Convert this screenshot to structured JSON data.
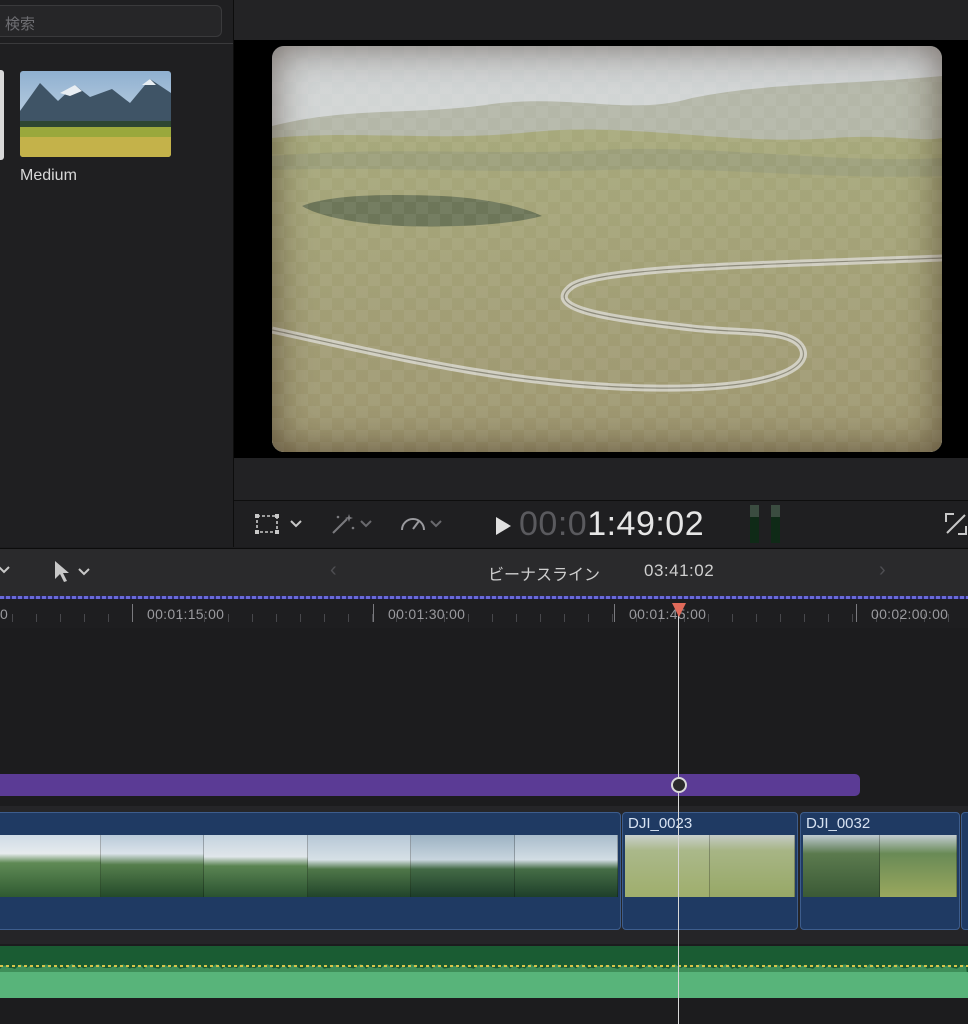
{
  "browser": {
    "search_placeholder": "検索",
    "clip_label": "Medium"
  },
  "viewer": {
    "timecode_dim": "00:0",
    "timecode_lit": "1:49:02"
  },
  "timeline": {
    "project_name": "ビーナスライン",
    "project_duration": "03:41:02",
    "ruler": [
      {
        "label": "0"
      },
      {
        "label": "00:01:15:00"
      },
      {
        "label": "00:01:30:00"
      },
      {
        "label": "00:01:45:00"
      },
      {
        "label": "00:02:00:00"
      }
    ],
    "clips": [
      {
        "name": ""
      },
      {
        "name": "DJI_0023"
      },
      {
        "name": "DJI_0032"
      }
    ]
  },
  "colors": {
    "title_bar": "#5b3b95",
    "clip_blue": "#1f3a63",
    "audio_green": "#1a5c33",
    "playhead": "#e06a5a"
  }
}
